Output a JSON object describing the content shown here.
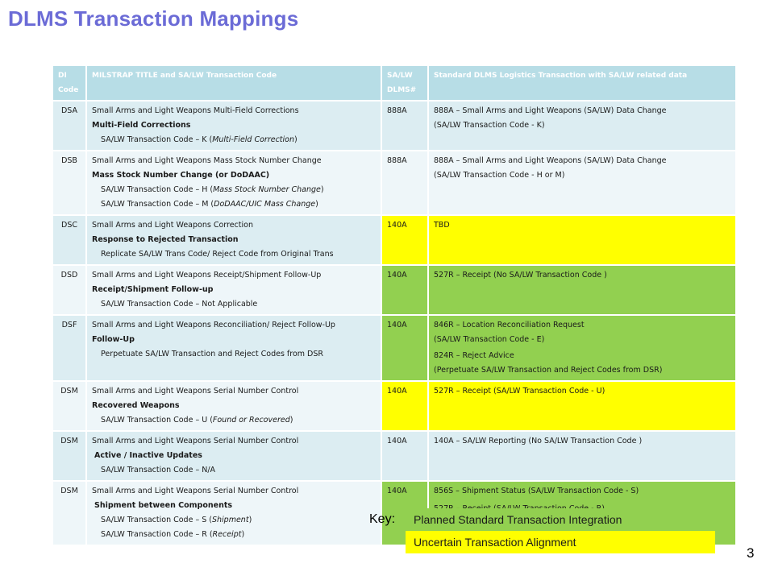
{
  "title": "DLMS Transaction Mappings",
  "header": {
    "di_code": "DI Code",
    "milstrap": "MILSTRAP TITLE and SA/LW Transaction Code",
    "dlms_num": "SA/LW DLMS#",
    "standard": "Standard DLMS Logistics Transaction with SA/LW related data"
  },
  "rows": [
    {
      "di": "DSA",
      "line1": "Small Arms and Light Weapons  Multi-Field Corrections",
      "line2": "Multi-Field Corrections",
      "l3_pre": "SA/LW Transaction Code – K  (",
      "l3_it": "Multi-Field Correction",
      "l3_post": ")",
      "dlms": "888A",
      "std1": "888A – Small Arms and Light Weapons (SA/LW) Data Change",
      "std2": "(SA/LW Transaction   Code  - K)"
    },
    {
      "di": "DSB",
      "line1": "Small Arms and Light Weapons Mass Stock Number Change",
      "line2": "Mass Stock Number Change (or DoDAAC)",
      "l3_pre": "SA/LW Transaction Code – H  (",
      "l3_it": "Mass Stock Number Change",
      "l3_post": ")",
      "l4_pre": "SA/LW Transaction Code – M  (",
      "l4_it": "DoDAAC/UIC Mass Change",
      "l4_post": ")",
      "dlms": "888A",
      "std1": "888A – Small Arms and Light Weapons (SA/LW) Data Change",
      "std2": "(SA/LW Transaction   Code  - H or M)"
    },
    {
      "di": "DSC",
      "line1": "Small Arms and Light Weapons Correction",
      "line2": "Response to Rejected Transaction",
      "line3": "Replicate SA/LW Trans Code/ Reject Code from Original Trans",
      "dlms": "140A",
      "std1": "TBD"
    },
    {
      "di": "DSD",
      "line1": "Small Arms and Light Weapons Receipt/Shipment Follow-Up",
      "line2": "Receipt/Shipment Follow-up",
      "line3": "SA/LW Transaction Code – Not Applicable",
      "dlms": "140A",
      "std1": "527R – Receipt  (No SA/LW Transaction  Code )"
    },
    {
      "di": "DSF",
      "line1": "Small Arms and Light Weapons Reconciliation/ Reject  Follow-Up",
      "line2": "Follow-Up",
      "line3": "Perpetuate SA/LW Transaction and Reject Codes  from DSR",
      "dlms": "140A",
      "std1": "846R – Location Reconciliation Request",
      "std2": "(SA/LW Transaction   Code  - E)",
      "std3": "824R – Reject Advice",
      "std4": "(Perpetuate SA/LW Transaction and Reject Codes  from DSR)"
    },
    {
      "di": "DSM",
      "line1": "Small Arms and Light Weapons Serial Number Control",
      "line2": "Recovered Weapons",
      "l3_pre": "SA/LW Transaction Code – U  (",
      "l3_it": "Found or Recovered",
      "l3_post": ")",
      "dlms": "140A",
      "std1": "527R – Receipt  (SA/LW Transaction   Code  - U)"
    },
    {
      "di": "DSM",
      "line1": "Small Arms and Light Weapons Serial Number Control",
      "line2": "Active / Inactive Updates",
      "line3": "SA/LW Transaction Code – N/A",
      "dlms": "140A",
      "std1": "140A – SA/LW Reporting  (No SA/LW Transaction  Code )"
    },
    {
      "di": "DSM",
      "line1": "Small Arms and Light Weapons Serial Number Control",
      "line2": "Shipment between Components",
      "l3_pre": "SA/LW Transaction Code – S  (",
      "l3_it": "Shipment",
      "l3_post": ")",
      "l4_pre": "SA/LW Transaction Code – R  (",
      "l4_it": "Receipt",
      "l4_post": ")",
      "dlms": "140A",
      "std1": "856S – Shipment Status    (SA/LW Transaction   Code  - S)",
      "std2": "527R – Receipt  (SA/LW Transaction   Code  - R)"
    }
  ],
  "key": {
    "label": "Key:",
    "green": "Planned Standard Transaction Integration",
    "yellow": "Uncertain Transaction Alignment",
    "green_color": "#92d050",
    "yellow_color": "#ffff00"
  },
  "page_number": "3"
}
